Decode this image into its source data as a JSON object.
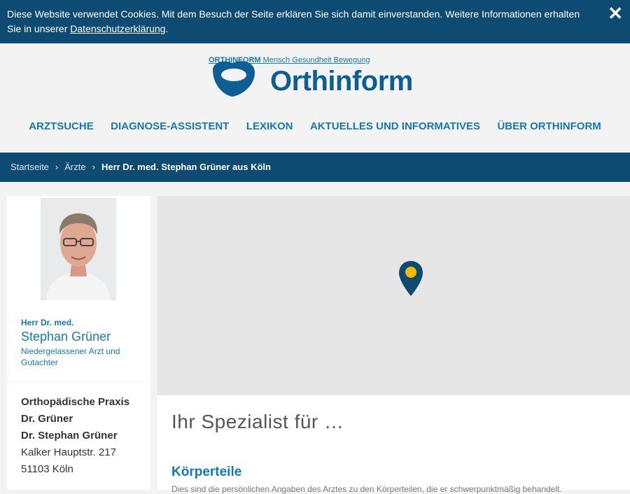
{
  "cookie": {
    "text": "Diese Website verwendet Cookies. Mit dem Besuch der Seite erklären Sie sich damit einverstanden. Weitere Informationen erhalten Sie in unserer ",
    "link": "Datenschutzerklärung",
    "after": ".",
    "close_icon": "close-icon"
  },
  "brand": {
    "line_bold": "ORTHINFORM",
    "line_rest": "Mensch Gesundheit Bewegung",
    "logo_word": "Orthinform"
  },
  "nav": [
    {
      "label": "ARZTSUCHE"
    },
    {
      "label": "DIAGNOSE-ASSISTENT"
    },
    {
      "label": "LEXIKON"
    },
    {
      "label": "AKTUELLES UND INFORMATIVES"
    },
    {
      "label": "ÜBER ORTHINFORM"
    }
  ],
  "breadcrumb": {
    "items": [
      "Startseite",
      "Ärzte"
    ],
    "current": "Herr Dr. med. Stephan Grüner aus Köln",
    "separator": "›"
  },
  "doctor": {
    "title": "Herr Dr. med.",
    "name": "Stephan Grüner",
    "role": "Niedergelassener Arzt und Gutachter"
  },
  "practice": {
    "line1": "Orthopädische Praxis",
    "line2": "Dr. Grüner",
    "line3": "Dr. Stephan Grüner",
    "street": "Kalker Hauptstr. 217",
    "city": "51103 Köln"
  },
  "content": {
    "heading": "Ihr Spezialist für …",
    "section_title": "Körperteile",
    "section_text": "Dies sind die persönlichen Angaben des Arztes zu den Körperteilen, die er schwerpunktmäßig behandelt."
  },
  "colors": {
    "primary": "#0d4b73",
    "accent": "#1479b2",
    "pin_yellow": "#f5b800"
  }
}
